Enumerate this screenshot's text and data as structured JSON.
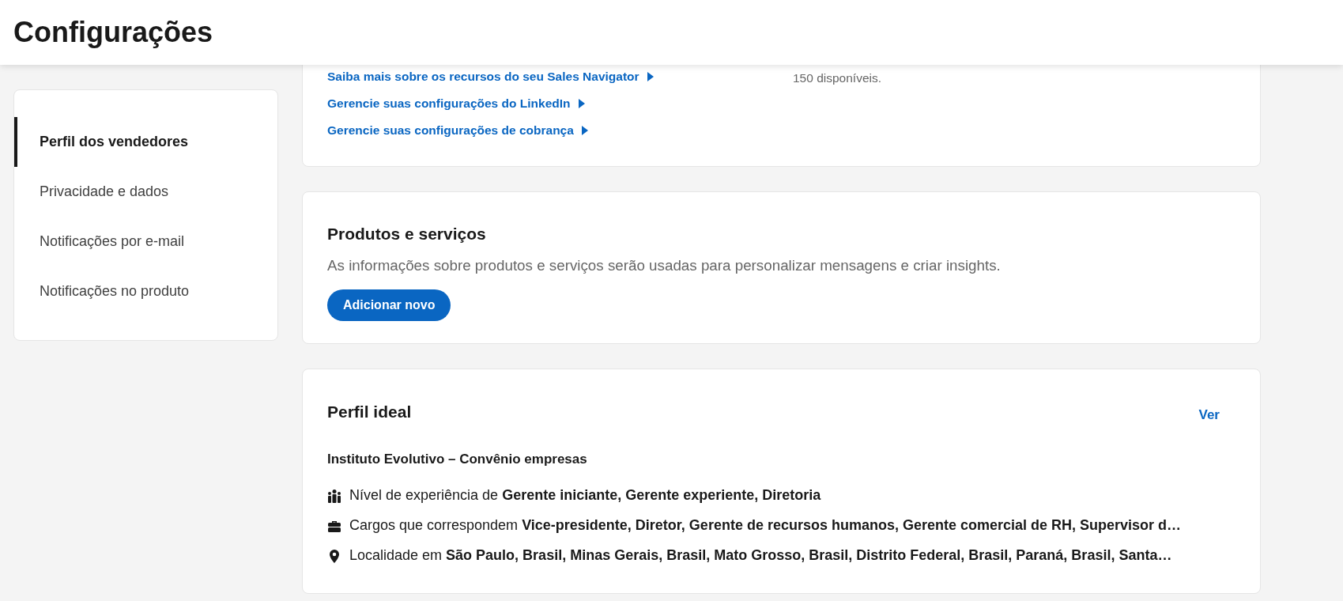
{
  "header": {
    "title": "Configurações"
  },
  "sidebar": {
    "items": [
      {
        "label": "Perfil dos vendedores",
        "selected": true
      },
      {
        "label": "Privacidade e dados",
        "selected": false
      },
      {
        "label": "Notificações por e-mail",
        "selected": false
      },
      {
        "label": "Notificações no produto",
        "selected": false
      }
    ]
  },
  "account_card": {
    "links": [
      "Saiba mais sobre os recursos do seu Sales Navigator",
      "Gerencie suas configurações do LinkedIn",
      "Gerencie suas configurações de cobrança"
    ],
    "note": "150 disponíveis."
  },
  "products_card": {
    "title": "Produtos e serviços",
    "description": "As informações sobre produtos e serviços serão usadas para personalizar mensagens e criar insights.",
    "button": "Adicionar novo"
  },
  "ideal_profile_card": {
    "title": "Perfil ideal",
    "action": "Ver",
    "name": "Instituto Evolutivo – Convênio empresas",
    "criteria": [
      {
        "kind": "people",
        "text": "Nível de experiência de **Gerente iniciante, Gerente experiente, Diretoria**"
      },
      {
        "kind": "briefcase",
        "text": "Cargos que correspondem **Vice-presidente, Diretor, Gerente de recursos humanos, Gerente comercial de RH, Supervisor d…**"
      },
      {
        "kind": "location",
        "text": "Localidade em **São Paulo, Brasil, Minas Gerais, Brasil, Mato Grosso, Brasil, Distrito Federal, Brasil, Paraná, Brasil, Santa…**"
      }
    ]
  }
}
